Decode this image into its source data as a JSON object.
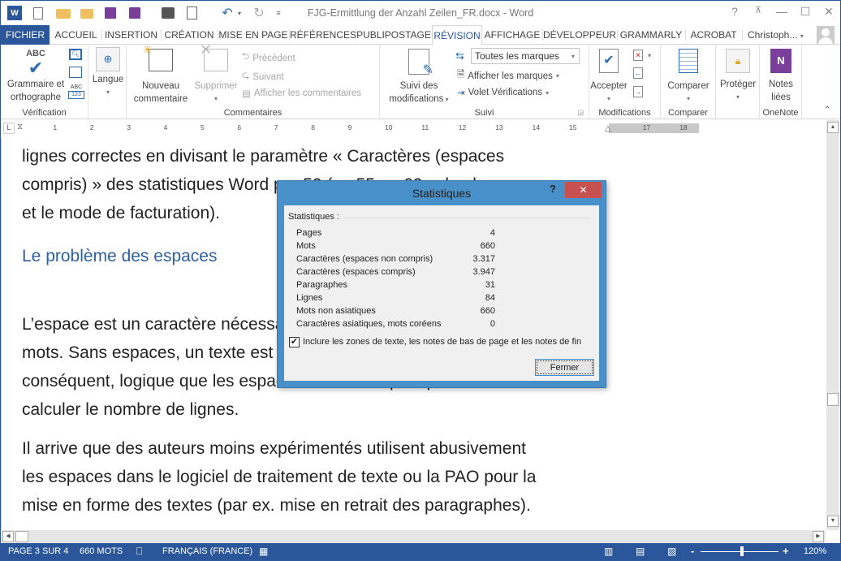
{
  "window": {
    "title": "FJG-Ermittlung der Anzahl Zeilen_FR.docx - Word",
    "controls": {
      "help": "?",
      "ribbon_options": "⊼",
      "minimize": "—",
      "maximize": "☐",
      "close": "✕"
    }
  },
  "quick_access": [
    "word-logo",
    "new-document",
    "open",
    "open-recent",
    "save",
    "save-as",
    "print-preview-quick",
    "print-preview",
    "undo",
    "redo",
    "customize"
  ],
  "tabs": [
    {
      "label": "FICHIER"
    },
    {
      "label": "ACCUEIL"
    },
    {
      "label": "INSERTION"
    },
    {
      "label": "CRÉATION"
    },
    {
      "label": "MISE EN PAGE"
    },
    {
      "label": "RÉFÉRENCES"
    },
    {
      "label": "PUBLIPOSTAGE"
    },
    {
      "label": "RÉVISION"
    },
    {
      "label": "AFFICHAGE"
    },
    {
      "label": "DÉVELOPPEUR"
    },
    {
      "label": "GRAMMARLY"
    },
    {
      "label": "ACROBAT"
    }
  ],
  "active_tab": "RÉVISION",
  "user": {
    "name": "Christoph..."
  },
  "ribbon": {
    "groups": {
      "verification": "Vérification",
      "langue": "",
      "commentaires": "Commentaires",
      "suivi": "Suivi",
      "modifications": "Modifications",
      "comparer": "Comparer",
      "onenote": "OneNote"
    },
    "grammaire": {
      "icon_text": "ABC",
      "line1": "Grammaire et",
      "line2": "orthographe"
    },
    "small_abc": "ABC",
    "small_123": "123",
    "langue": "Langue",
    "nouveau": {
      "line1": "Nouveau",
      "line2": "commentaire"
    },
    "supprimer": "Supprimer",
    "precedent": "Précédent",
    "suivant": "Suivant",
    "afficher_commentaires": "Afficher les commentaires",
    "suivi_modifs": {
      "line1": "Suivi des",
      "line2": "modifications"
    },
    "marques_select": "Toutes les marques",
    "afficher_marques": "Afficher les marques",
    "volet": "Volet Vérifications",
    "accepter": "Accepter",
    "comparer_btn": "Comparer",
    "proteger": "Protéger",
    "notes_liees": {
      "line1": "Notes",
      "line2": "liées"
    }
  },
  "ruler": {
    "numbers": [
      "1",
      "2",
      "3",
      "4",
      "5",
      "6",
      "7",
      "8",
      "9",
      "10",
      "11",
      "12",
      "13",
      "14",
      "15",
      "17",
      "18"
    ]
  },
  "document": {
    "lines_top": [
      "lignes correctes en divisant le paramètre « Caractères (espaces",
      "compris) » des statistiques Word par 50 (ou 55 ou 60 selon la",
      "et le mode de facturation)."
    ],
    "heading": "Le problème des espaces",
    "para2": [
      "L’espace est un caractère nécessaire à la séparation des",
      "mots. Sans espaces, un texte est illisible. Il est, par",
      "conséquent, logique que les espaces soient comptés pour",
      "calculer le nombre de lignes."
    ],
    "para3": [
      "Il arrive que des auteurs moins expérimentés utilisent abusivement",
      "les espaces dans le logiciel de traitement de texte ou la PAO pour la",
      "mise en forme des textes (par ex. mise en retrait des paragraphes)."
    ]
  },
  "dialog": {
    "title": "Statistiques",
    "help": "?",
    "close": "✕",
    "section": "Statistiques :",
    "rows": [
      {
        "label": "Pages",
        "value": "4"
      },
      {
        "label": "Mots",
        "value": "660"
      },
      {
        "label": "Caractères (espaces non compris)",
        "value": "3.317"
      },
      {
        "label": "Caractères (espaces compris)",
        "value": "3.947"
      },
      {
        "label": "Paragraphes",
        "value": "31"
      },
      {
        "label": "Lignes",
        "value": "84"
      },
      {
        "label": "Mots non asiatiques",
        "value": "660"
      },
      {
        "label": "Caractères asiatiques, mots coréens",
        "value": "0"
      }
    ],
    "checkbox_checked": true,
    "checkbox_label": "Inclure les zones de texte, les notes de bas de page et les notes de fin",
    "close_button": "Fermer"
  },
  "status": {
    "page": "PAGE 3 SUR 4",
    "words": "660 MOTS",
    "language": "FRANÇAIS (FRANCE)",
    "zoom_minus": "-",
    "zoom_plus": "+",
    "zoom": "120%",
    "zoom_level_percent": 120
  },
  "colors": {
    "accent": "#2b579a",
    "heading": "#2e5f9e",
    "dialog_frame": "#4a90c8",
    "dialog_close": "#c75050"
  }
}
